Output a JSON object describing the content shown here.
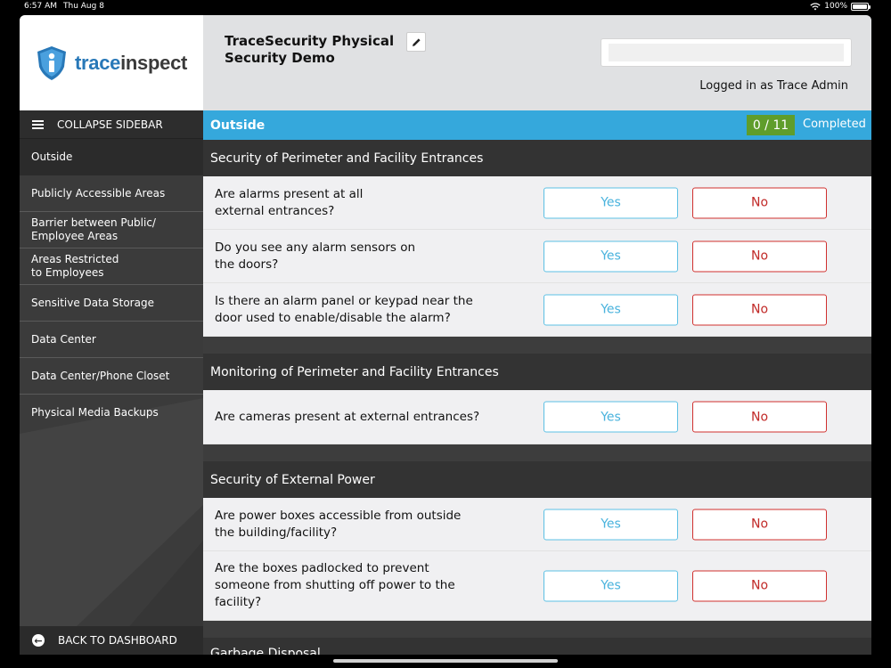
{
  "status_bar": {
    "time": "6:57 AM",
    "date": "Thu Aug 8",
    "battery": "100%"
  },
  "brand": {
    "logo_part1": "trace",
    "logo_part2": "inspect"
  },
  "sidebar": {
    "collapse_label": "COLLAPSE SIDEBAR",
    "items": [
      {
        "label": "Outside",
        "active": true
      },
      {
        "label": "Publicly Accessible Areas"
      },
      {
        "label": "Barrier between Public/ Employee Areas"
      },
      {
        "label": "Areas Restricted to Employees"
      },
      {
        "label": "Sensitive Data Storage"
      },
      {
        "label": "Data Center"
      },
      {
        "label": "Data Center/Phone Closet"
      },
      {
        "label": "Physical Media Backups"
      }
    ],
    "back_label": "BACK TO DASHBOARD"
  },
  "header": {
    "title": "TraceSecurity Physical Security Demo",
    "logged_in": "Logged in as Trace Admin"
  },
  "section": {
    "name": "Outside",
    "progress": "0 / 11",
    "completed_label": "Completed"
  },
  "groups": [
    {
      "title": "Security of Perimeter and Facility Entrances",
      "questions": [
        {
          "text": "Are alarms present at all external entrances?",
          "yes": "Yes",
          "no": "No"
        },
        {
          "text": "Do you see any alarm sensors on the doors?",
          "yes": "Yes",
          "no": "No"
        },
        {
          "text": "Is there an alarm panel or keypad near the door used to enable/disable the alarm?",
          "yes": "Yes",
          "no": "No"
        }
      ]
    },
    {
      "title": "Monitoring of Perimeter and Facility Entrances",
      "questions": [
        {
          "text": "Are cameras present at external entrances?",
          "yes": "Yes",
          "no": "No"
        }
      ]
    },
    {
      "title": "Security of External Power",
      "questions": [
        {
          "text": "Are power boxes accessible from outside the building/facility?",
          "yes": "Yes",
          "no": "No"
        },
        {
          "text": "Are the boxes padlocked to prevent someone from shutting off power to the facility?",
          "yes": "Yes",
          "no": "No"
        }
      ]
    }
  ],
  "next_group_title": "Garbage Disposal",
  "colors": {
    "accent": "#35a8dc",
    "yes": "#4ab3dd",
    "no": "#c12a28",
    "badge": "#5f9d2b"
  }
}
